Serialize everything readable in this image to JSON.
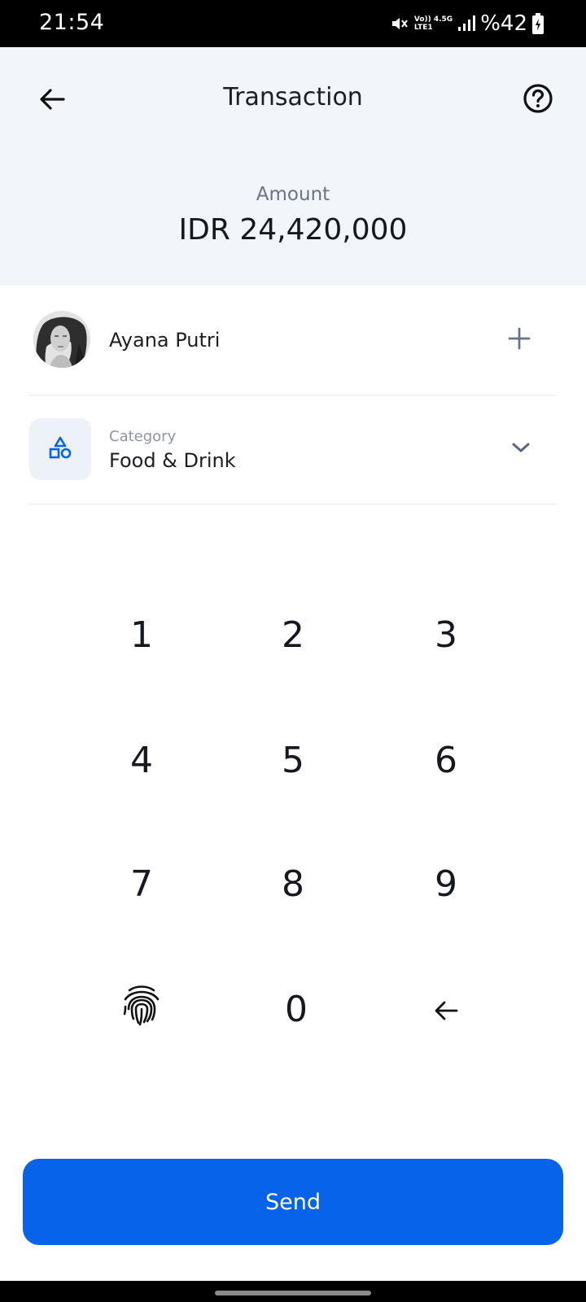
{
  "status_bar": {
    "time": "21:54",
    "network_top": "Vo)) 4.5G",
    "network_bottom": "LTE1",
    "battery": "%42"
  },
  "header": {
    "title": "Transaction",
    "amount_label": "Amount",
    "amount_value": "IDR 24,420,000"
  },
  "recipient": {
    "name": "Ayana Putri"
  },
  "category": {
    "label": "Category",
    "value": "Food & Drink"
  },
  "keypad": {
    "keys": [
      "1",
      "2",
      "3",
      "4",
      "5",
      "6",
      "7",
      "8",
      "9",
      "0"
    ]
  },
  "send_button": {
    "label": "Send"
  },
  "colors": {
    "accent": "#0764ea",
    "header_bg": "#f2f5fa"
  },
  "icons": [
    "back-arrow-icon",
    "help-circle-icon",
    "plus-icon",
    "shapes-icon",
    "chevron-down-icon",
    "fingerprint-icon",
    "backspace-arrow-icon"
  ]
}
